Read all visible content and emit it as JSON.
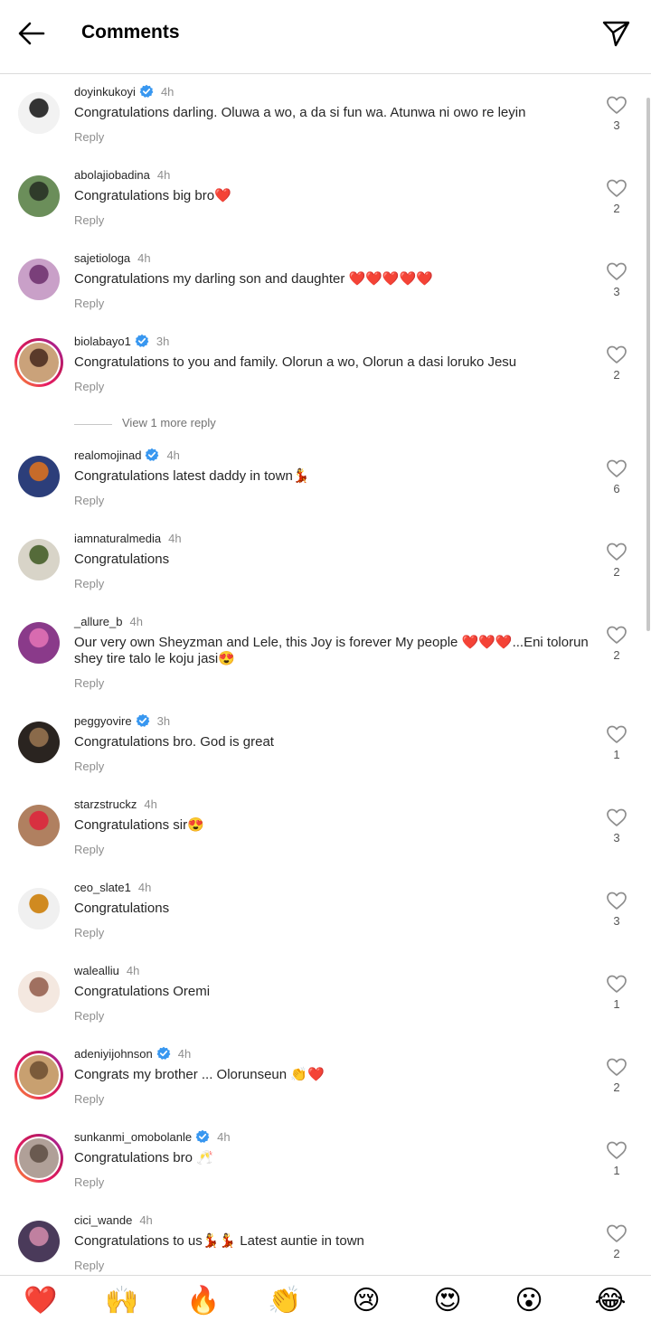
{
  "header": {
    "title": "Comments"
  },
  "view_more": "View 1 more reply",
  "reply_label": "Reply",
  "colors": {
    "like_red": "#ed4956",
    "verified_blue": "#3897f0",
    "text": "#262626",
    "meta": "#8e8e8e"
  },
  "comments": [
    {
      "user": "doyinkukoyi",
      "verified": true,
      "time": "4h",
      "text": "Congratulations darling. Oluwa a wo, a da si fun wa. Atunwa ni owo re leyin",
      "likes": "3",
      "story": false
    },
    {
      "user": "abolajiobadina",
      "verified": false,
      "time": "4h",
      "text": "Congratulations big bro❤️",
      "likes": "2",
      "story": false
    },
    {
      "user": "sajetiologa",
      "verified": false,
      "time": "4h",
      "text": "Congratulations my darling son and daughter ❤️❤️❤️❤️❤️",
      "likes": "3",
      "story": false
    },
    {
      "user": "biolabayo1",
      "verified": true,
      "time": "3h",
      "text": "Congratulations to you and family. Olorun a wo, Olorun a dasi loruko Jesu",
      "likes": "2",
      "story": true
    },
    {
      "user": "realomojinad",
      "verified": true,
      "time": "4h",
      "text": "Congratulations latest daddy in town💃",
      "likes": "6",
      "story": false
    },
    {
      "user": "iamnaturalmedia",
      "verified": false,
      "time": "4h",
      "text": "Congratulations",
      "likes": "2",
      "story": false
    },
    {
      "user": "_allure_b",
      "verified": false,
      "time": "4h",
      "text": "Our very own Sheyzman and Lele, this Joy is forever My people ❤️❤️❤️...Eni tolorun shey tire talo le koju jasi😍",
      "likes": "2",
      "story": false
    },
    {
      "user": "peggyovire",
      "verified": true,
      "time": "3h",
      "text": "Congratulations bro. God is great",
      "likes": "1",
      "story": false
    },
    {
      "user": "starzstruckz",
      "verified": false,
      "time": "4h",
      "text": "Congratulations sir😍",
      "likes": "3",
      "story": false
    },
    {
      "user": "ceo_slate1",
      "verified": false,
      "time": "4h",
      "text": "Congratulations",
      "likes": "3",
      "story": false
    },
    {
      "user": "walealliu",
      "verified": false,
      "time": "4h",
      "text": "Congratulations Oremi",
      "likes": "1",
      "story": false
    },
    {
      "user": "adeniyijohnson",
      "verified": true,
      "time": "4h",
      "text": "Congrats my brother ... Olorunseun 👏❤️",
      "likes": "2",
      "story": true
    },
    {
      "user": "sunkanmi_omobolanle",
      "verified": true,
      "time": "4h",
      "text": "Congratulations bro 🥂",
      "likes": "1",
      "story": true
    },
    {
      "user": "cici_wande",
      "verified": false,
      "time": "4h",
      "text": "Congratulations to us💃💃 Latest auntie in town",
      "likes": "2",
      "story": false
    }
  ],
  "reactions": [
    "❤️",
    "🙌",
    "🔥",
    "👏",
    "😢",
    "😍",
    "😮",
    "😂"
  ]
}
